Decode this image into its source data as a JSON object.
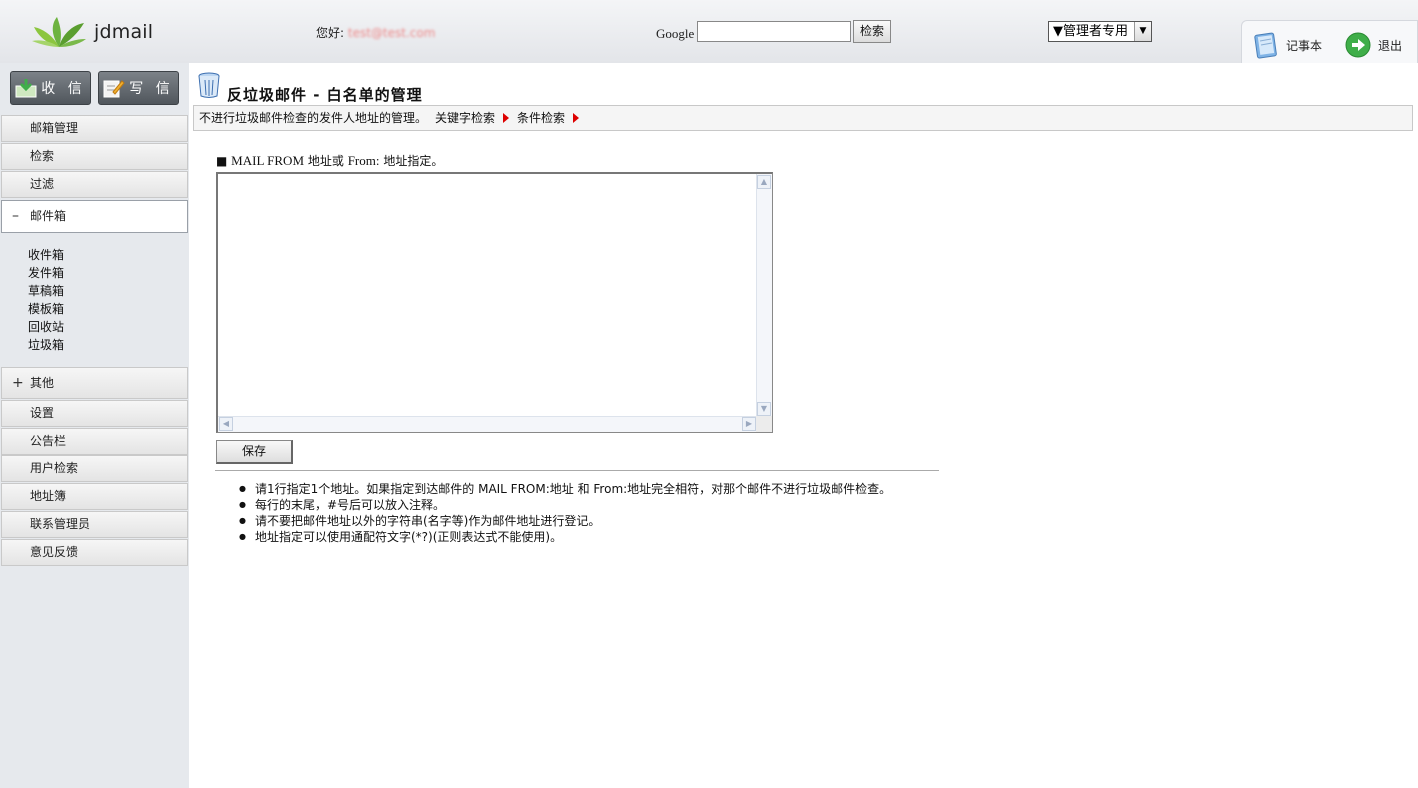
{
  "header": {
    "logo_text": "jdmail",
    "greeting_label": "您好:",
    "greeting_user": "test@test.com",
    "google_label": "Google",
    "search_button": "检索",
    "admin_select": "▼管理者专用",
    "notepad_label": "记事本",
    "logout_label": "退出"
  },
  "sidebar": {
    "receive_button": "收 信",
    "compose_button": "写 信",
    "items": [
      {
        "label": "邮箱管理"
      },
      {
        "label": "检索"
      },
      {
        "label": "过滤"
      },
      {
        "label": "邮件箱",
        "sign": "–"
      }
    ],
    "mailbox_sub": [
      "收件箱",
      "发件箱",
      "草稿箱",
      "模板箱",
      "回收站",
      "垃圾箱"
    ],
    "bottom_items": [
      {
        "label": "其他",
        "sign": "+"
      },
      {
        "label": "设置"
      },
      {
        "label": "公告栏"
      },
      {
        "label": "用户检索"
      },
      {
        "label": "地址簿"
      },
      {
        "label": "联系管理员"
      },
      {
        "label": "意见反馈"
      }
    ]
  },
  "main": {
    "title": "反垃圾邮件 - 白名单的管理",
    "info_text": "不进行垃圾邮件检查的发件人地址的管理。",
    "link_keyword": "关键字检索",
    "link_condition": "条件检索",
    "field_label_prefix": "■",
    "field_label_mailfrom": "MAIL FROM",
    "field_label_mid": "地址或",
    "field_label_from": "From:",
    "field_label_suffix": "地址指定。",
    "textarea_value": "",
    "save_button": "保存",
    "notes": [
      "请1行指定1个地址。如果指定到达邮件的 MAIL FROM:地址 和 From:地址完全相符，对那个邮件不进行垃圾邮件检查。",
      "每行的末尾，#号后可以放入注释。",
      "请不要把邮件地址以外的字符串(名字等)作为邮件地址进行登记。",
      "地址指定可以使用通配符文字(*?)(正则表达式不能使用)。"
    ]
  },
  "colors": {
    "sidebar_bg": "#e6e9ed",
    "arrow_red": "#dd0000",
    "mail_button": "#5e646a",
    "header_bg": "#e8eaee"
  }
}
